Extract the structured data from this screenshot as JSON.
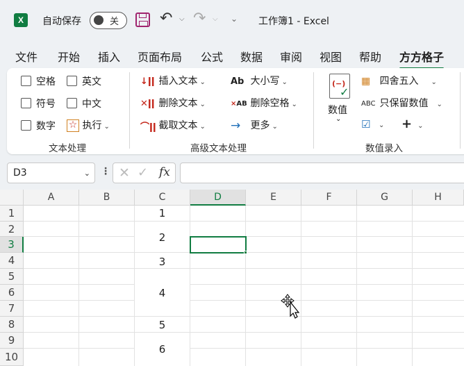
{
  "titlebar": {
    "app_icon": "X",
    "autosave_label": "自动保存",
    "autosave_state": "关",
    "doc_title": "工作簿1  -  Excel"
  },
  "tabs": [
    "文件",
    "开始",
    "插入",
    "页面布局",
    "公式",
    "数据",
    "审阅",
    "视图",
    "帮助",
    "方方格子"
  ],
  "active_tab": "方方格子",
  "ribbon": {
    "text_group": {
      "label": "文本处理",
      "checkboxes": [
        "空格",
        "英文",
        "符号",
        "中文",
        "数字"
      ],
      "execute_label": "执行"
    },
    "advanced_group": {
      "label": "高级文本处理",
      "insert": "插入文本",
      "delete": "删除文本",
      "extract": "截取文本",
      "case_icon": "Ab",
      "case": "大小写",
      "spaces_icon": "AB",
      "remove_spaces": "删除空格",
      "more": "更多"
    },
    "number_group": {
      "label": "数值录入",
      "value_label": "数值",
      "rounding": "四舍五入",
      "keep_values_icon": "ABC",
      "keep_values": "只保留数值",
      "plus": "+"
    }
  },
  "formula_bar": {
    "name_box": "D3",
    "fx": "fx",
    "content": ""
  },
  "grid": {
    "columns": [
      "A",
      "B",
      "C",
      "D",
      "E",
      "F",
      "G",
      "H"
    ],
    "rows": [
      "1",
      "2",
      "3",
      "4",
      "5",
      "6",
      "7",
      "8",
      "9",
      "10"
    ],
    "active_cell": "D3",
    "column_c_values": [
      "1",
      "2",
      "3",
      "4",
      "5",
      "6"
    ]
  },
  "colors": {
    "accent": "#107c41",
    "ribbon_red": "#c4281c"
  }
}
